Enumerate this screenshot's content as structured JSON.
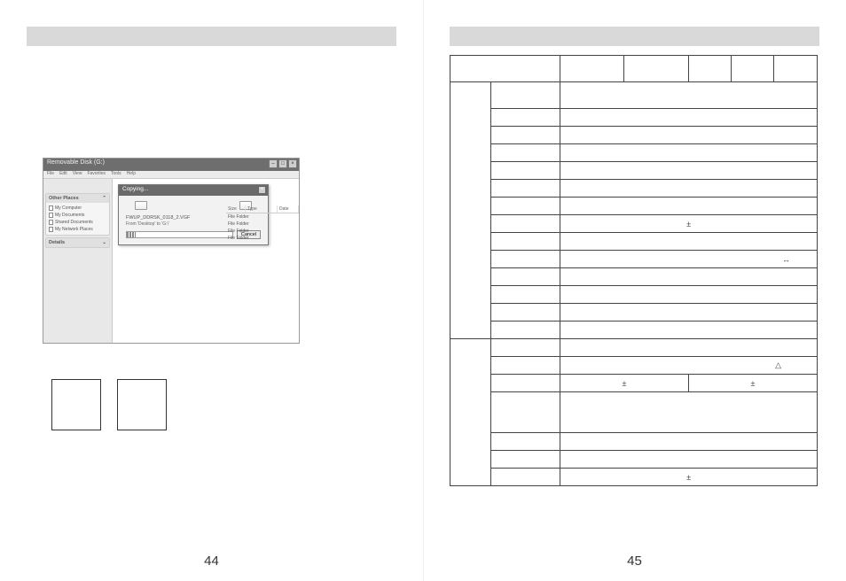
{
  "pages": {
    "left_number": "44",
    "right_number": "45"
  },
  "screenshot": {
    "window_title": "Removable Disk (G:)",
    "menubar": [
      "File",
      "Edit",
      "View",
      "Favorites",
      "Tools",
      "Help"
    ],
    "dialog": {
      "title": "Copying...",
      "filename": "FWUP_DDRSK_0118_2.VGF",
      "from_line": "From 'Desktop' to 'G:\\'",
      "cancel_label": "Cancel"
    },
    "list_header": {
      "size": "Size",
      "type": "Type",
      "date": "Date"
    },
    "list_rows": [
      "File Folder",
      "File Folder",
      "File Folder",
      "File Folder"
    ],
    "other_places": {
      "header": "Other Places",
      "items": [
        "My Computer",
        "My Documents",
        "Shared Documents",
        "My Network Places"
      ]
    },
    "details_header": "Details"
  },
  "spec_symbols": {
    "pm": "±",
    "arrows": "↔",
    "triangle": "△"
  }
}
